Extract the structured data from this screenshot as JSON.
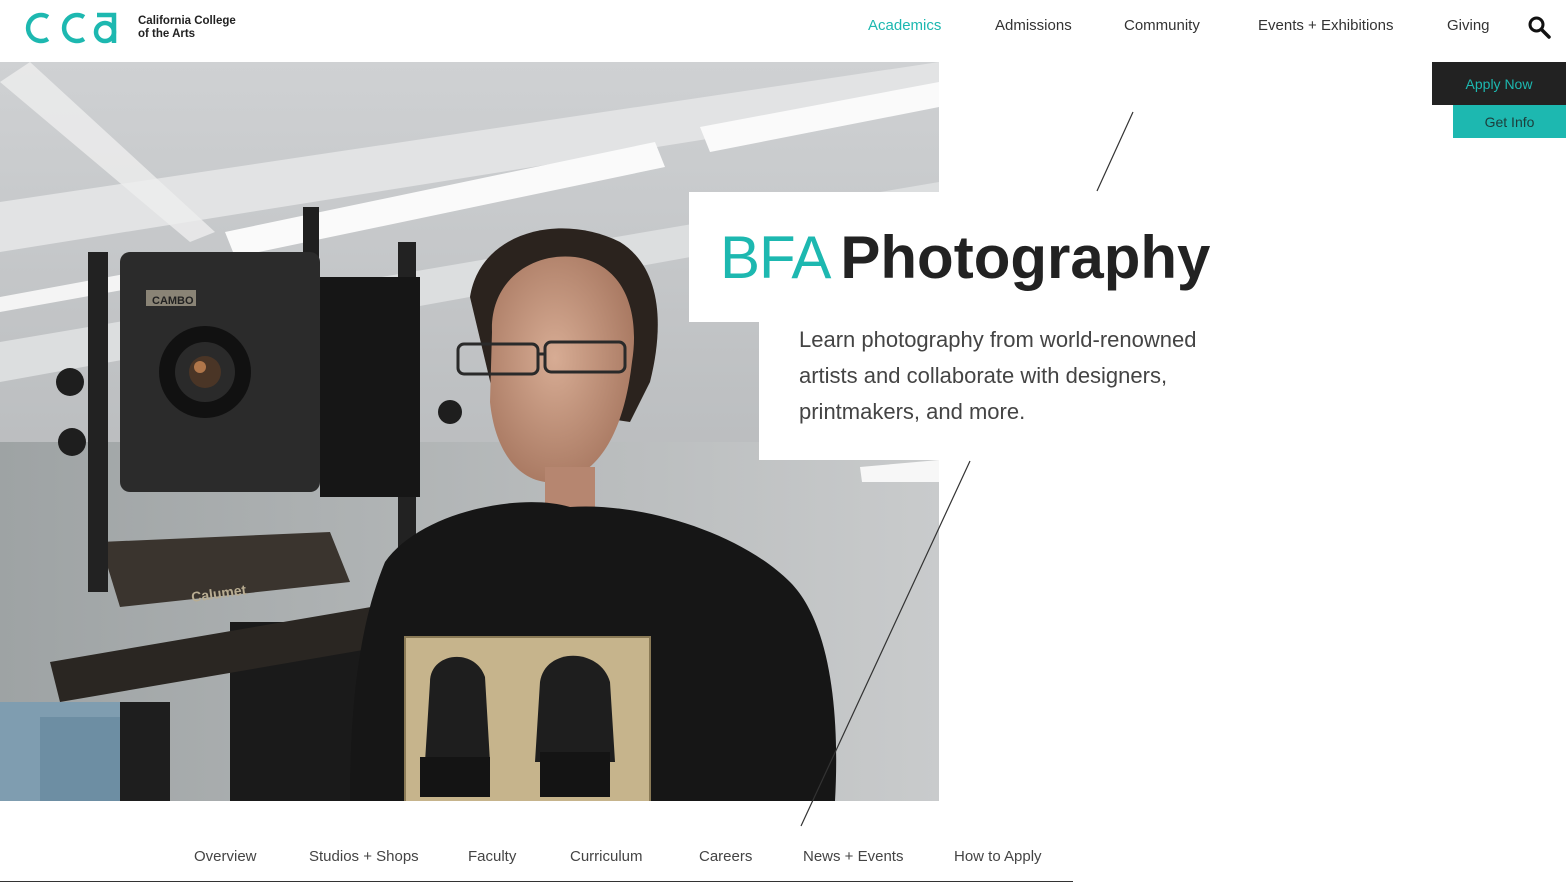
{
  "brand": {
    "logo_letters": "CCA",
    "name_line1": "California College",
    "name_line2": "of the Arts",
    "accent_color": "#1db8b0"
  },
  "header": {
    "nav": [
      {
        "label": "Academics",
        "active": true
      },
      {
        "label": "Admissions",
        "active": false
      },
      {
        "label": "Community",
        "active": false
      },
      {
        "label": "Events + Exhibitions",
        "active": false
      },
      {
        "label": "Giving",
        "active": false
      }
    ],
    "search_icon": "search-icon",
    "apply_label": "Apply Now",
    "info_label": "Get Info"
  },
  "hero": {
    "title_prefix": "BFA",
    "title_main": "Photography",
    "description": "Learn photography from world-renowned artists and collaborate with designers, printmakers, and more.",
    "photo_camera_text": "Calumet",
    "photo_lens_brand": "CAMBO"
  },
  "subnav": {
    "items": [
      "Overview",
      "Studios + Shops",
      "Faculty",
      "Curriculum",
      "Careers",
      "News + Events",
      "How to Apply"
    ]
  }
}
